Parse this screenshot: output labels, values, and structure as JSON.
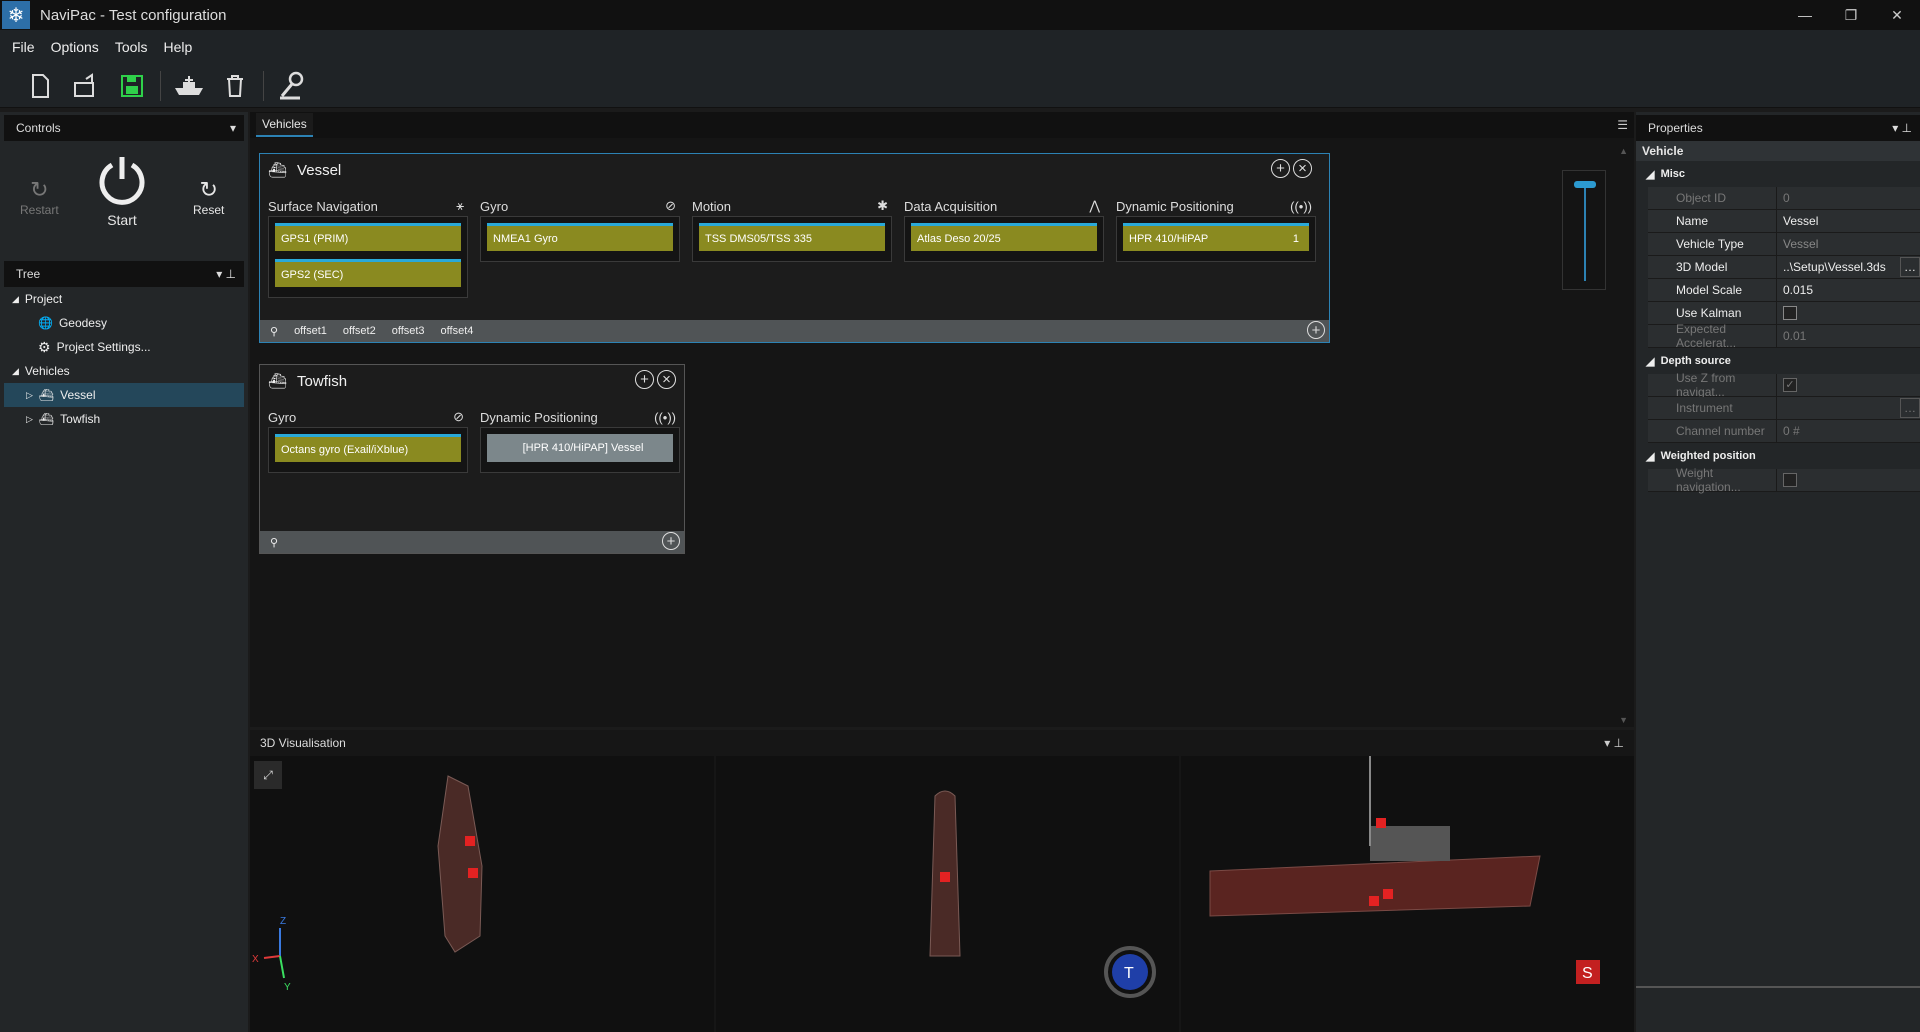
{
  "window": {
    "title": "NaviPac - Test configuration",
    "minimize": "—",
    "restore": "❐",
    "close": "✕"
  },
  "menu": [
    "File",
    "Options",
    "Tools",
    "Help"
  ],
  "controls": {
    "header": "Controls",
    "restart": "Restart",
    "start": "Start",
    "reset": "Reset"
  },
  "tree": {
    "header": "Tree",
    "project": "Project",
    "geodesy": "Geodesy",
    "project_settings": "Project Settings...",
    "vehicles": "Vehicles",
    "vessel": "Vessel",
    "towfish": "Towfish"
  },
  "center": {
    "tab": "Vehicles"
  },
  "vessel": {
    "name": "Vessel",
    "groups": {
      "surface_navigation": {
        "title": "Surface Navigation",
        "devices": [
          "GPS1 (PRIM)",
          "GPS2 (SEC)"
        ]
      },
      "gyro": {
        "title": "Gyro",
        "devices": [
          "NMEA1 Gyro"
        ]
      },
      "motion": {
        "title": "Motion",
        "devices": [
          "TSS DMS05/TSS 335"
        ]
      },
      "data_acquisition": {
        "title": "Data Acquisition",
        "devices": [
          "Atlas Deso 20/25"
        ]
      },
      "dynamic_positioning": {
        "title": "Dynamic Positioning",
        "devices": [
          "HPR 410/HiPAP"
        ],
        "count": "1"
      }
    },
    "offsets": [
      "offset1",
      "offset2",
      "offset3",
      "offset4"
    ]
  },
  "towfish": {
    "name": "Towfish",
    "groups": {
      "gyro": {
        "title": "Gyro",
        "devices": [
          "Octans gyro (Exail/iXblue)"
        ]
      },
      "dynamic_positioning": {
        "title": "Dynamic Positioning",
        "devices": [
          "[HPR 410/HiPAP] Vessel"
        ]
      }
    }
  },
  "visualisation": {
    "header": "3D Visualisation",
    "axis_x": "X",
    "axis_y": "Y",
    "axis_z": "Z",
    "marker_t": "T",
    "marker_s": "S"
  },
  "properties": {
    "header": "Properties",
    "category": "Vehicle",
    "sections": {
      "misc": "Misc",
      "depth": "Depth source",
      "weighted": "Weighted position"
    },
    "rows": {
      "object_id": {
        "k": "Object ID",
        "v": "0"
      },
      "name": {
        "k": "Name",
        "v": "Vessel"
      },
      "vehicle_type": {
        "k": "Vehicle Type",
        "v": "Vessel"
      },
      "model": {
        "k": "3D Model",
        "v": "..\\Setup\\Vessel.3ds"
      },
      "scale": {
        "k": "Model Scale",
        "v": "0.015"
      },
      "kalman": {
        "k": "Use Kalman",
        "v": ""
      },
      "accel": {
        "k": "Expected Accelerat...",
        "v": "0.01"
      },
      "usez": {
        "k": "Use Z from navigat...",
        "v": ""
      },
      "instrument": {
        "k": "Instrument",
        "v": ""
      },
      "channel": {
        "k": "Channel number",
        "v": "0 #"
      },
      "weight": {
        "k": "Weight navigation...",
        "v": ""
      }
    }
  },
  "colors": {
    "accent": "#2c82b4",
    "device": "#8a8a20",
    "device_top": "#29a9d8"
  }
}
